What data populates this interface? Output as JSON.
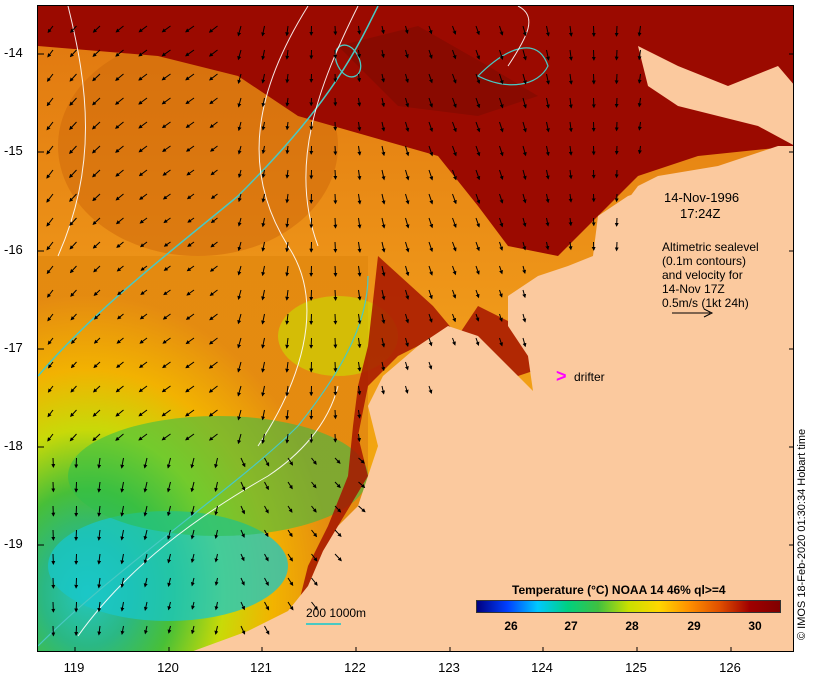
{
  "map": {
    "date_label": "14-Nov-1996",
    "time_label": "17:24Z",
    "altimetry_lines": [
      "Altimetric sealevel",
      "(0.1m contours)",
      "and velocity for",
      "14-Nov 17Z",
      "0.5m/s (1kt 24h)"
    ],
    "drifter_label": "drifter",
    "depth_contours_label": "200  1000m",
    "credit": "© IMOS 18-Feb-2020 01:30:34 Hobart time"
  },
  "axes": {
    "lat_ticks": [
      "-14",
      "-15",
      "-16",
      "-17",
      "-18",
      "-19"
    ],
    "lon_ticks": [
      "119",
      "120",
      "121",
      "122",
      "123",
      "124",
      "125",
      "126"
    ]
  },
  "colorbar": {
    "title": "Temperature (°C) NOAA 14 46% ql>=4",
    "ticks": [
      "26",
      "27",
      "28",
      "29",
      "30"
    ],
    "stops": [
      "#000080",
      "#0040ff",
      "#00c8ff",
      "#00d080",
      "#40c040",
      "#c8e000",
      "#ffd700",
      "#ff9000",
      "#e05000",
      "#a00000",
      "#800000"
    ]
  },
  "colors": {
    "land": "#fbc99e",
    "hot": "#9b0a00",
    "depth_contour": "#49c9c3"
  }
}
